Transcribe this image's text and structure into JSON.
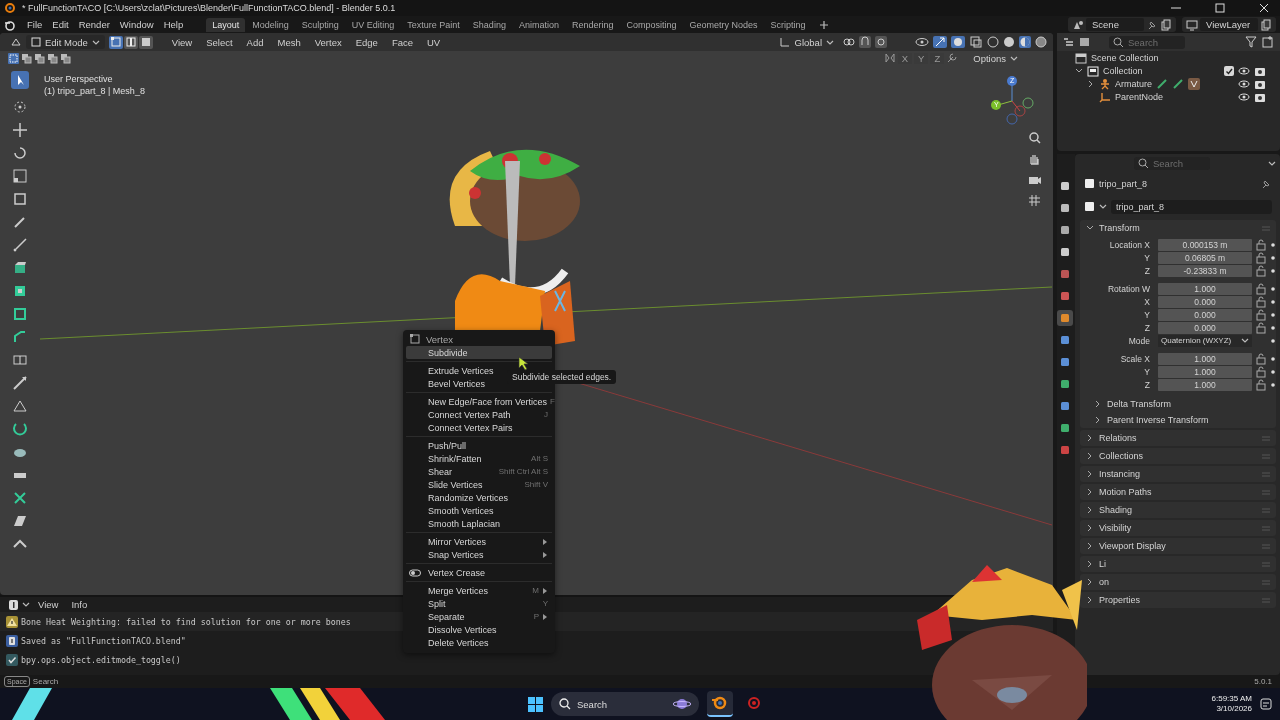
{
  "window": {
    "title": "* FullFunctionTACO [C:\\Users\\zclat\\Pictures\\Blender\\FullFunctionTACO.blend] - Blender 5.0.1"
  },
  "menu_bar": {
    "menus": [
      "File",
      "Edit",
      "Render",
      "Window",
      "Help"
    ],
    "workspaces": [
      {
        "label": "Layout",
        "selected": true
      },
      {
        "label": "Modeling",
        "selected": false
      },
      {
        "label": "Sculpting",
        "selected": false
      },
      {
        "label": "UV Editing",
        "selected": false
      },
      {
        "label": "Texture Paint",
        "selected": false
      },
      {
        "label": "Shading",
        "selected": false
      },
      {
        "label": "Animation",
        "selected": false
      },
      {
        "label": "Rendering",
        "selected": false
      },
      {
        "label": "Compositing",
        "selected": false
      },
      {
        "label": "Geometry Nodes",
        "selected": false
      },
      {
        "label": "Scripting",
        "selected": false
      }
    ],
    "scene": "Scene",
    "view_layer": "ViewLayer"
  },
  "viewport": {
    "mode": "Edit Mode",
    "select_modes": [
      {
        "selected": true
      },
      {
        "selected": false
      },
      {
        "selected": false
      }
    ],
    "menus": [
      "View",
      "Select",
      "Add",
      "Mesh",
      "Vertex",
      "Edge",
      "Face",
      "UV"
    ],
    "orientation": "Global",
    "axes": [
      "X",
      "Y",
      "Z"
    ],
    "options": "Options",
    "view_name": "User Perspective",
    "object_info": "(1) tripo_part_8 | Mesh_8",
    "gizmo_labels": [
      "Z",
      "Y"
    ],
    "context_menu": {
      "title": "Vertex",
      "groups": [
        [
          {
            "label": "Subdivide",
            "kind": "item",
            "selected": true
          }
        ],
        [
          {
            "label": "Extrude Vertices",
            "kind": "item",
            "selected": false
          },
          {
            "label": "Bevel Vertices",
            "kind": "item",
            "selected": false
          }
        ],
        [
          {
            "label": "New Edge/Face from Vertices",
            "shortcut": "F",
            "kind": "item",
            "selected": false
          },
          {
            "label": "Connect Vertex Path",
            "shortcut": "J",
            "kind": "item",
            "selected": false
          },
          {
            "label": "Connect Vertex Pairs",
            "kind": "item",
            "selected": false
          }
        ],
        [
          {
            "label": "Push/Pull",
            "kind": "item",
            "selected": false
          },
          {
            "label": "Shrink/Fatten",
            "shortcut": "Alt S",
            "kind": "item",
            "selected": false
          },
          {
            "label": "Shear",
            "shortcut": "Shift Ctrl Alt S",
            "kind": "item",
            "selected": false
          },
          {
            "label": "Slide Vertices",
            "shortcut": "Shift V",
            "kind": "item",
            "selected": false
          },
          {
            "label": "Randomize Vertices",
            "kind": "item",
            "selected": false
          },
          {
            "label": "Smooth Vertices",
            "kind": "item",
            "selected": false
          },
          {
            "label": "Smooth Laplacian",
            "kind": "item",
            "selected": false
          }
        ],
        [
          {
            "label": "Mirror Vertices",
            "kind": "submenu",
            "selected": false
          },
          {
            "label": "Snap Vertices",
            "kind": "submenu",
            "selected": false
          }
        ],
        [
          {
            "label": "Vertex Crease",
            "kind": "toggle",
            "selected": false
          }
        ],
        [
          {
            "label": "Merge Vertices",
            "shortcut": "M",
            "kind": "submenu",
            "selected": false
          },
          {
            "label": "Split",
            "shortcut": "Y",
            "kind": "item",
            "selected": false
          },
          {
            "label": "Separate",
            "shortcut": "P",
            "kind": "submenu",
            "selected": false
          },
          {
            "label": "Dissolve Vertices",
            "kind": "item",
            "selected": false
          },
          {
            "label": "Delete Vertices",
            "kind": "item",
            "selected": false
          }
        ]
      ]
    },
    "tooltip": "Subdivide selected edges."
  },
  "outliner": {
    "search_placeholder": "Search",
    "tree": [
      {
        "label": "Scene Collection",
        "kind": "scene",
        "children": [
          {
            "label": "Collection",
            "kind": "collection",
            "expanded": true,
            "checked": true,
            "children": [
              {
                "label": "Armature",
                "kind": "armature",
                "expanded": false
              },
              {
                "label": "ParentNode",
                "kind": "empty"
              }
            ]
          }
        ]
      }
    ]
  },
  "properties": {
    "search_placeholder": "Search",
    "tabs": [
      {
        "selected": false
      },
      {
        "selected": false
      },
      {
        "selected": false
      },
      {
        "selected": false
      },
      {
        "selected": false
      },
      {
        "selected": false
      },
      {
        "selected": true
      },
      {
        "selected": false
      },
      {
        "selected": false
      },
      {
        "selected": false
      },
      {
        "selected": false
      },
      {
        "selected": false
      },
      {
        "selected": false
      }
    ],
    "object_name": "tripo_part_8",
    "data_name": "tripo_part_8",
    "transform": {
      "title": "Transform",
      "expanded": true,
      "groups": [
        [
          {
            "label": "Location X",
            "value": "0.000153 m",
            "kind": "field"
          },
          {
            "label": "Y",
            "value": "0.06805 m",
            "kind": "field"
          },
          {
            "label": "Z",
            "value": "-0.23833 m",
            "kind": "field"
          }
        ],
        [
          {
            "label": "Rotation W",
            "value": "1.000",
            "kind": "field"
          },
          {
            "label": "X",
            "value": "0.000",
            "kind": "field"
          },
          {
            "label": "Y",
            "value": "0.000",
            "kind": "field"
          },
          {
            "label": "Z",
            "value": "0.000",
            "kind": "field"
          },
          {
            "label": "Mode",
            "value": "Quaternion (WXYZ)",
            "kind": "dropdown"
          }
        ],
        [
          {
            "label": "Scale X",
            "value": "1.000",
            "kind": "field"
          },
          {
            "label": "Y",
            "value": "1.000",
            "kind": "field"
          },
          {
            "label": "Z",
            "value": "1.000",
            "kind": "field"
          }
        ]
      ],
      "subpanels": [
        {
          "label": "Delta Transform",
          "expanded": false
        },
        {
          "label": "Parent Inverse Transform",
          "expanded": false
        }
      ]
    },
    "panels": [
      {
        "label": "Relations",
        "expanded": false
      },
      {
        "label": "Collections",
        "expanded": false
      },
      {
        "label": "Instancing",
        "expanded": false
      },
      {
        "label": "Motion Paths",
        "expanded": false
      },
      {
        "label": "Shading",
        "expanded": false
      },
      {
        "label": "Visibility",
        "expanded": false
      },
      {
        "label": "Viewport Display",
        "expanded": false
      },
      {
        "label": "Li",
        "expanded": false
      },
      {
        "label": "on",
        "expanded": false
      },
      {
        "label": "Properties",
        "expanded": false
      }
    ]
  },
  "info": {
    "menus": [
      "View",
      "Info"
    ],
    "reports": [
      {
        "kind": "warning",
        "text": "Bone Heat Weighting: failed to find solution for one or more bones"
      },
      {
        "kind": "info",
        "text": "Saved as \"FullFunctionTACO.blend\""
      },
      {
        "kind": "operator",
        "text": "bpy.ops.object.editmode_toggle()"
      }
    ]
  },
  "status_bar": {
    "key": "Space",
    "action": "Search",
    "version": "5.0.1"
  },
  "taskbar": {
    "search_placeholder": "Search",
    "apps": [
      {
        "kind": "blender",
        "active": true
      },
      {
        "kind": "record",
        "active": false
      }
    ],
    "time": "6:59:35 AM",
    "date": "3/10/2026"
  }
}
